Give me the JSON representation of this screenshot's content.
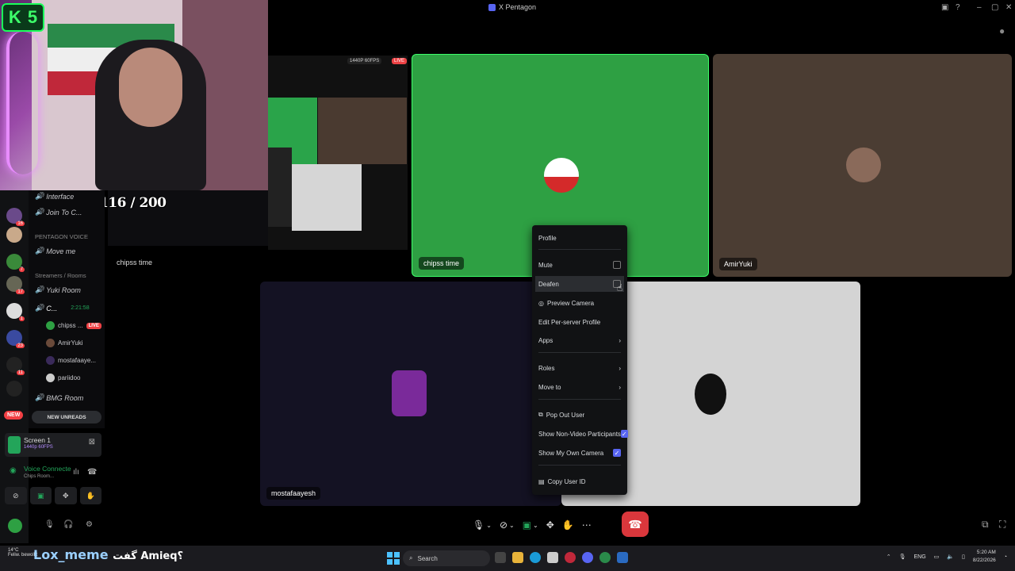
{
  "window": {
    "title": "X Pentagon"
  },
  "overlay": {
    "badge_letter": "K",
    "badge_number": "5",
    "followers_text": "FOLLOWERS 116 / 200"
  },
  "sidebar": {
    "categories": {
      "pentagon_voice": "PENTAGON VOICE",
      "streamers_rooms": "Streamers / Rooms"
    },
    "channels": {
      "interface": "Interface",
      "join_to": "Join To C...",
      "move_me": "Move me",
      "yuki_room": "Yuki Room",
      "chips_room": "C...",
      "chips_time": "2:21:58",
      "bmg_room": "BMG Room"
    },
    "voice_users": [
      {
        "name": "chipss ...",
        "live": "LIVE"
      },
      {
        "name": "AmirYuki",
        "live": ""
      },
      {
        "name": "mostafaaye...",
        "live": ""
      },
      {
        "name": "pariidoo",
        "live": ""
      }
    ],
    "new_badge": "NEW",
    "new_unreads": "NEW UNREADS",
    "screen_share": {
      "title": "Screen 1",
      "subtitle": "1440p 60FPS"
    },
    "voice": {
      "status": "Voice Connecte",
      "room": "Chips Room..."
    }
  },
  "preview": {
    "quality": "1440P 60FPS",
    "live": "LIVE",
    "channel_label": "chipss time"
  },
  "tiles": {
    "chipss": "chipss time",
    "amir": "AmirYuki",
    "mostafa": "mostafaayesh"
  },
  "context_menu": {
    "profile": "Profile",
    "mute": "Mute",
    "deafen": "Deafen",
    "preview_camera": "Preview Camera",
    "edit_profile": "Edit Per-server Profile",
    "apps": "Apps",
    "roles": "Roles",
    "move_to": "Move to",
    "pop_out": "Pop Out User",
    "show_non_video": "Show Non-Video Participants",
    "show_own_camera": "Show My Own Camera",
    "copy_id": "Copy User ID",
    "checks": {
      "mute": false,
      "deafen": false,
      "show_non_video": true,
      "show_own_camera": true
    }
  },
  "taskbar": {
    "weather_temp": "14°C",
    "weather_desc": "Feliw. bewolkt",
    "stream_text": "Lox_meme",
    "stream_text2": "گفت Amieq؟",
    "search": "Search",
    "lang": "ENG",
    "time": "5:20 AM",
    "date": "8/22/2026"
  },
  "colors": {
    "accent": "#5865f2",
    "live": "#ed4245",
    "green_tile": "#2ea043",
    "hangup": "#da373c"
  }
}
